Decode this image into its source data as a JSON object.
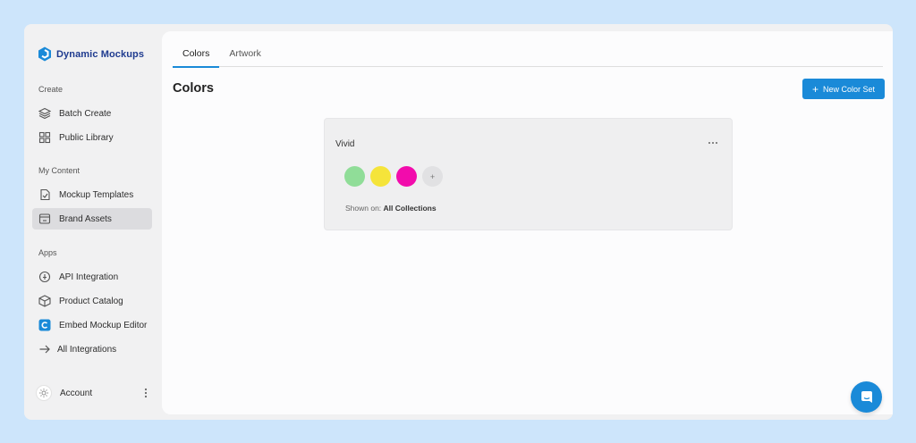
{
  "brand": {
    "name": "Dynamic Mockups",
    "color": "#1f3b8f"
  },
  "sidebar": {
    "sections": [
      {
        "label": "Create"
      },
      {
        "label": "My Content"
      },
      {
        "label": "Apps"
      }
    ],
    "items": [
      {
        "label": "Batch Create",
        "icon": "layers-icon"
      },
      {
        "label": "Public Library",
        "icon": "grid-icon"
      },
      {
        "label": "Mockup Templates",
        "icon": "template-icon"
      },
      {
        "label": "Brand Assets",
        "icon": "brand-assets-icon",
        "active": true
      },
      {
        "label": "API Integration",
        "icon": "api-icon"
      },
      {
        "label": "Product Catalog",
        "icon": "box-icon"
      },
      {
        "label": "Embed Mockup Editor",
        "icon": "embed-logo-icon"
      },
      {
        "label": "All Integrations",
        "icon": "arrow-right-icon"
      }
    ],
    "account": {
      "label": "Account"
    }
  },
  "tabs": [
    {
      "label": "Colors",
      "active": true
    },
    {
      "label": "Artwork",
      "active": false
    }
  ],
  "page": {
    "title": "Colors",
    "new_button_label": "New Color Set"
  },
  "color_set": {
    "name": "Vivid",
    "colors": [
      "#90dd98",
      "#f5e43a",
      "#f20cac"
    ],
    "add_label": "+",
    "shown_on_label": "Shown on:",
    "shown_on_value": "All Collections"
  },
  "accent": "#1a8ad8"
}
